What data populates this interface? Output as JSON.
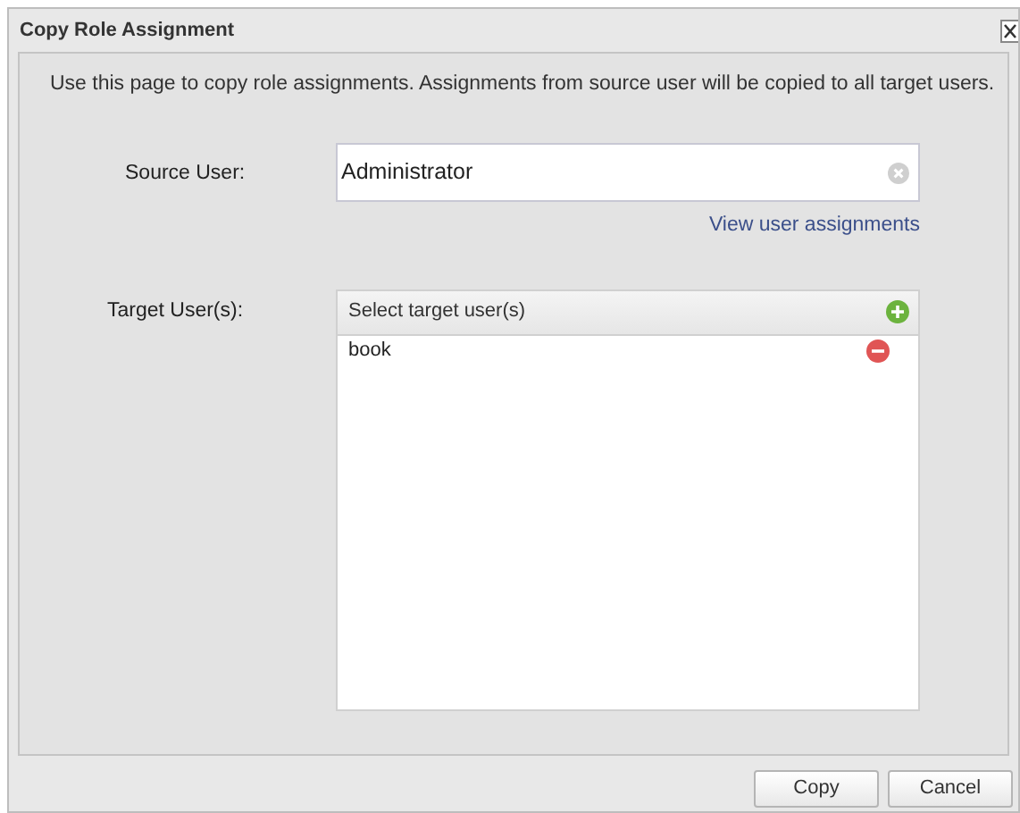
{
  "window": {
    "title": "Copy Role Assignment"
  },
  "description": "Use this page to copy role assignments. Assignments from source user will be copied to all target users.",
  "source_user": {
    "label": "Source User:",
    "value": "Administrator",
    "link": "View user assignments"
  },
  "target_users": {
    "label": "Target User(s):",
    "header": "Select target user(s)",
    "items": [
      {
        "name": "book"
      }
    ]
  },
  "buttons": [
    "Copy",
    "Cancel"
  ]
}
